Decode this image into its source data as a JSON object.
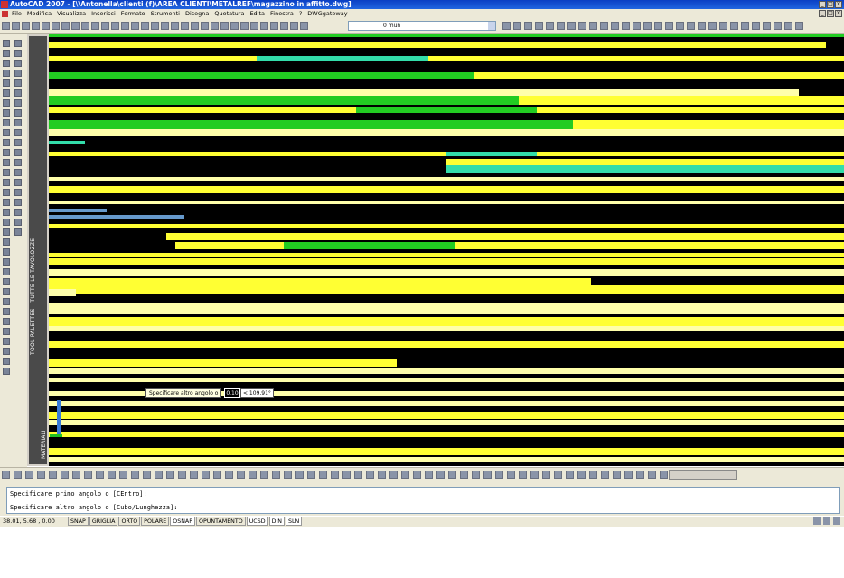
{
  "window": {
    "title": "AutoCAD 2007 - [\\\\Antonella\\clienti (f)\\AREA CLIENTI\\METALREF\\magazzino in affitto.dwg]",
    "buttons": [
      "_",
      "□",
      "×"
    ]
  },
  "menubar": {
    "items": [
      "File",
      "Modifica",
      "Visualizza",
      "Inserisci",
      "Formato",
      "Strumenti",
      "Disegna",
      "Quotatura",
      "Edita",
      "Finestra",
      "?",
      "DWGgateway"
    ]
  },
  "toolbar": {
    "layer_value": "0 mun"
  },
  "palette": {
    "title": "TOOL PALETTES - TUTTE LE TAVOLOZZE",
    "tab_label": "MATERIALI"
  },
  "dynamic_input": {
    "prompt": "Specificare altro angolo o",
    "value": "0.10",
    "angle": "< 109.91°"
  },
  "command_line": {
    "lines": [
      "Specificare primo angolo o [CEntro]:",
      "Specificare altro angolo o [Cubo/Lunghezza]:"
    ]
  },
  "status_bar": {
    "coords": "38.01, 5.68 , 0.00",
    "toggles": [
      {
        "label": "SNAP",
        "on": false
      },
      {
        "label": "GRIGLIA",
        "on": false
      },
      {
        "label": "ORTO",
        "on": false
      },
      {
        "label": "POLARE",
        "on": false
      },
      {
        "label": "OSNAP",
        "on": true
      },
      {
        "label": "OPUNTAMENTO",
        "on": false
      },
      {
        "label": "UCSD",
        "on": true
      },
      {
        "label": "DIN",
        "on": true
      },
      {
        "label": "SLN",
        "on": true
      }
    ]
  },
  "colors": {
    "yellow": "#ffff33",
    "pale_yellow": "#ffffaa",
    "green": "#22cc22",
    "cyan_green": "#33ddaa",
    "blue": "#6699cc",
    "black": "#000000"
  }
}
